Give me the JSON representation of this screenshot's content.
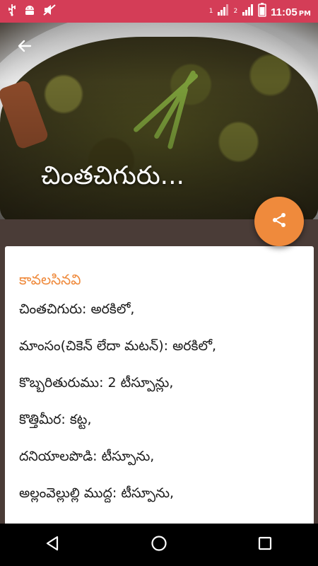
{
  "status_bar": {
    "time": "11:05",
    "ampm": "PM",
    "sim1": "1",
    "sim2": "2",
    "icons": [
      "usb-icon",
      "android-icon",
      "mute-icon",
      "signal-sim1-icon",
      "signal-sim2-icon",
      "battery-icon"
    ],
    "background_color": "#d43d57"
  },
  "header": {
    "title": "చింతచిగురు...",
    "back_icon": "arrow-left-icon"
  },
  "fab": {
    "icon": "share-icon",
    "color": "#ef8a3c"
  },
  "content": {
    "section_heading": "కావలసినవి",
    "ingredients": [
      "చింతచిగురు: అరకిలో,",
      "మాంసం(చికెన్ లేదా మటన్): అరకిలో,",
      "కొబ్బరితురుము: 2 టీస్పూన్లు,",
      "కొత్తిమీర: కట్ట,",
      "దనియాలపొడి: టీస్పూను,",
      "అల్లంవెల్లుల్లి ముద్ద: టీస్పూను,"
    ],
    "accent_color": "#ef8a3c"
  },
  "nav_bar": {
    "back": "nav-back-icon",
    "home": "nav-home-icon",
    "recents": "nav-recents-icon"
  }
}
